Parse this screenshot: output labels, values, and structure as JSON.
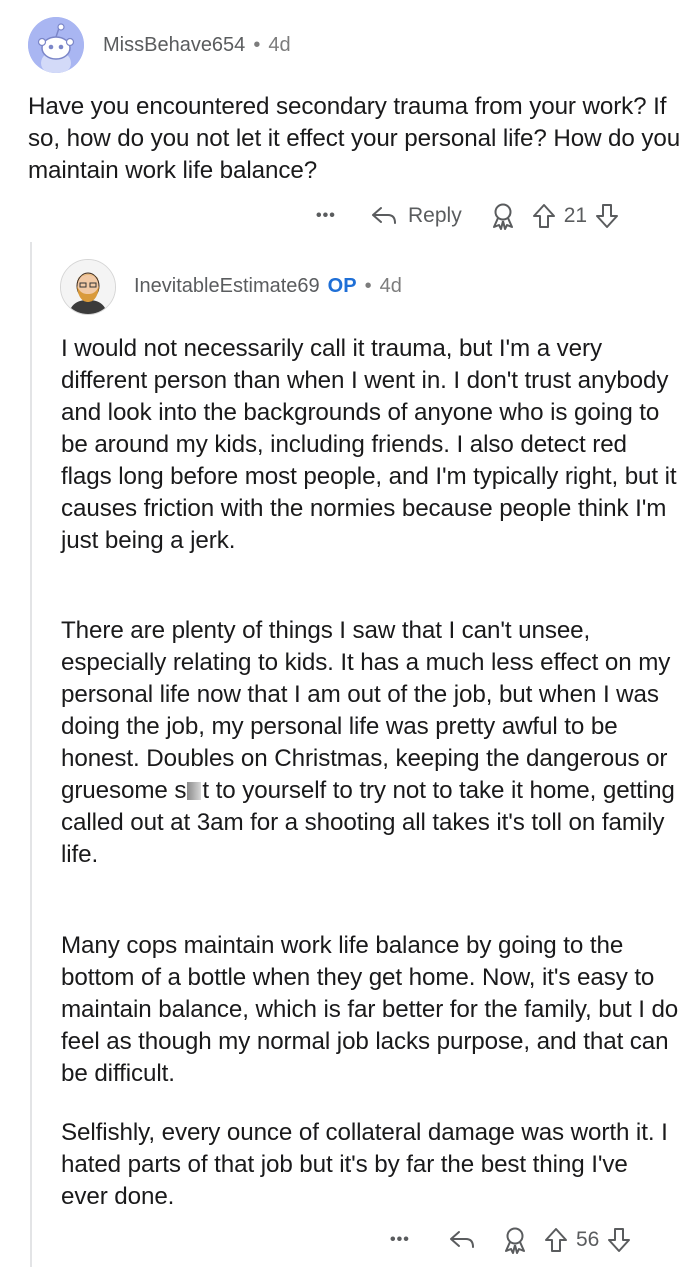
{
  "top_comment": {
    "username": "MissBehave654",
    "separator": "•",
    "age": "4d",
    "body": "Have you encountered secondary trauma from your work? If so, how do you not let it effect your personal life? How do you maintain work life balance?",
    "actions": {
      "more_label": "•••",
      "reply_label": "Reply",
      "score": "21"
    }
  },
  "reply": {
    "username": "InevitableEstimate69",
    "op_badge": "OP",
    "separator": "•",
    "age": "4d",
    "paragraphs": [
      "I would not necessarily call it trauma, but I'm a very different person than when I went in. I don't trust anybody and look into the backgrounds of anyone who is going to be around my kids, including friends. I also detect red flags long before most people, and I'm typically right, but it causes friction with the normies because people think I'm just being a jerk.",
      "There are plenty of things I saw that I can't unsee, especially relating to kids. It has a much less effect on my personal life now that I am out of the job, but when I was doing the job, my personal life was pretty awful to be honest. Doubles on Christmas, keeping the dangerous or gruesome",
      "t to yourself to try not to take it home, getting called out at 3am for a shooting all takes it's toll on family life.",
      "Many cops maintain work life balance by going to the bottom of a bottle when they get home. Now, it's easy to maintain balance, which is far better for the family, but I do feel as though my normal job lacks purpose, and that can be difficult.",
      "Selfishly, every ounce of collateral damage was worth it. I hated parts of that job but it's by far the best thing I've ever done."
    ],
    "censored_prefix": "s",
    "actions": {
      "more_label": "•••",
      "score": "56"
    }
  },
  "colors": {
    "avatar_bg": "#a9b6f2",
    "op_blue": "#1f6fd6",
    "meta_gray": "#7c7c7c"
  }
}
